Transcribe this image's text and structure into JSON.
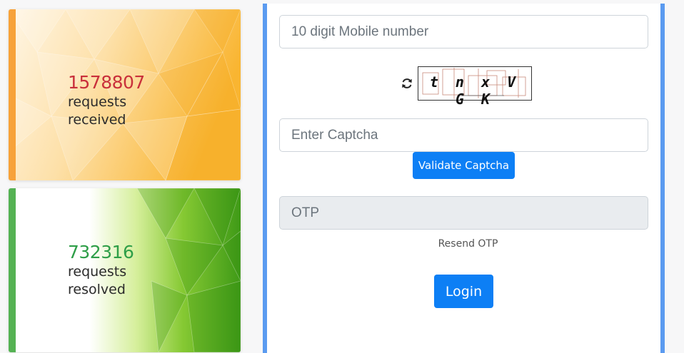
{
  "stats": {
    "received": {
      "count": "1578807",
      "line1": "requests",
      "line2": "received"
    },
    "resolved": {
      "count": "732316",
      "line1": "requests",
      "line2": "resolved"
    }
  },
  "login": {
    "mobile_placeholder": "10 digit Mobile number",
    "captcha_text": "t n x V G K",
    "captcha_placeholder": "Enter Captcha",
    "validate_label": "Validate Captcha",
    "otp_placeholder": "OTP",
    "resend_label": "Resend OTP",
    "login_label": "Login"
  },
  "icons": {
    "refresh": "refresh-icon"
  },
  "colors": {
    "received_accent": "#f7a23a",
    "received_number": "#c9303b",
    "resolved_accent": "#55b253",
    "resolved_number": "#2e9e48",
    "primary": "#0d7ff5",
    "panel_border": "#5b9bf0"
  }
}
